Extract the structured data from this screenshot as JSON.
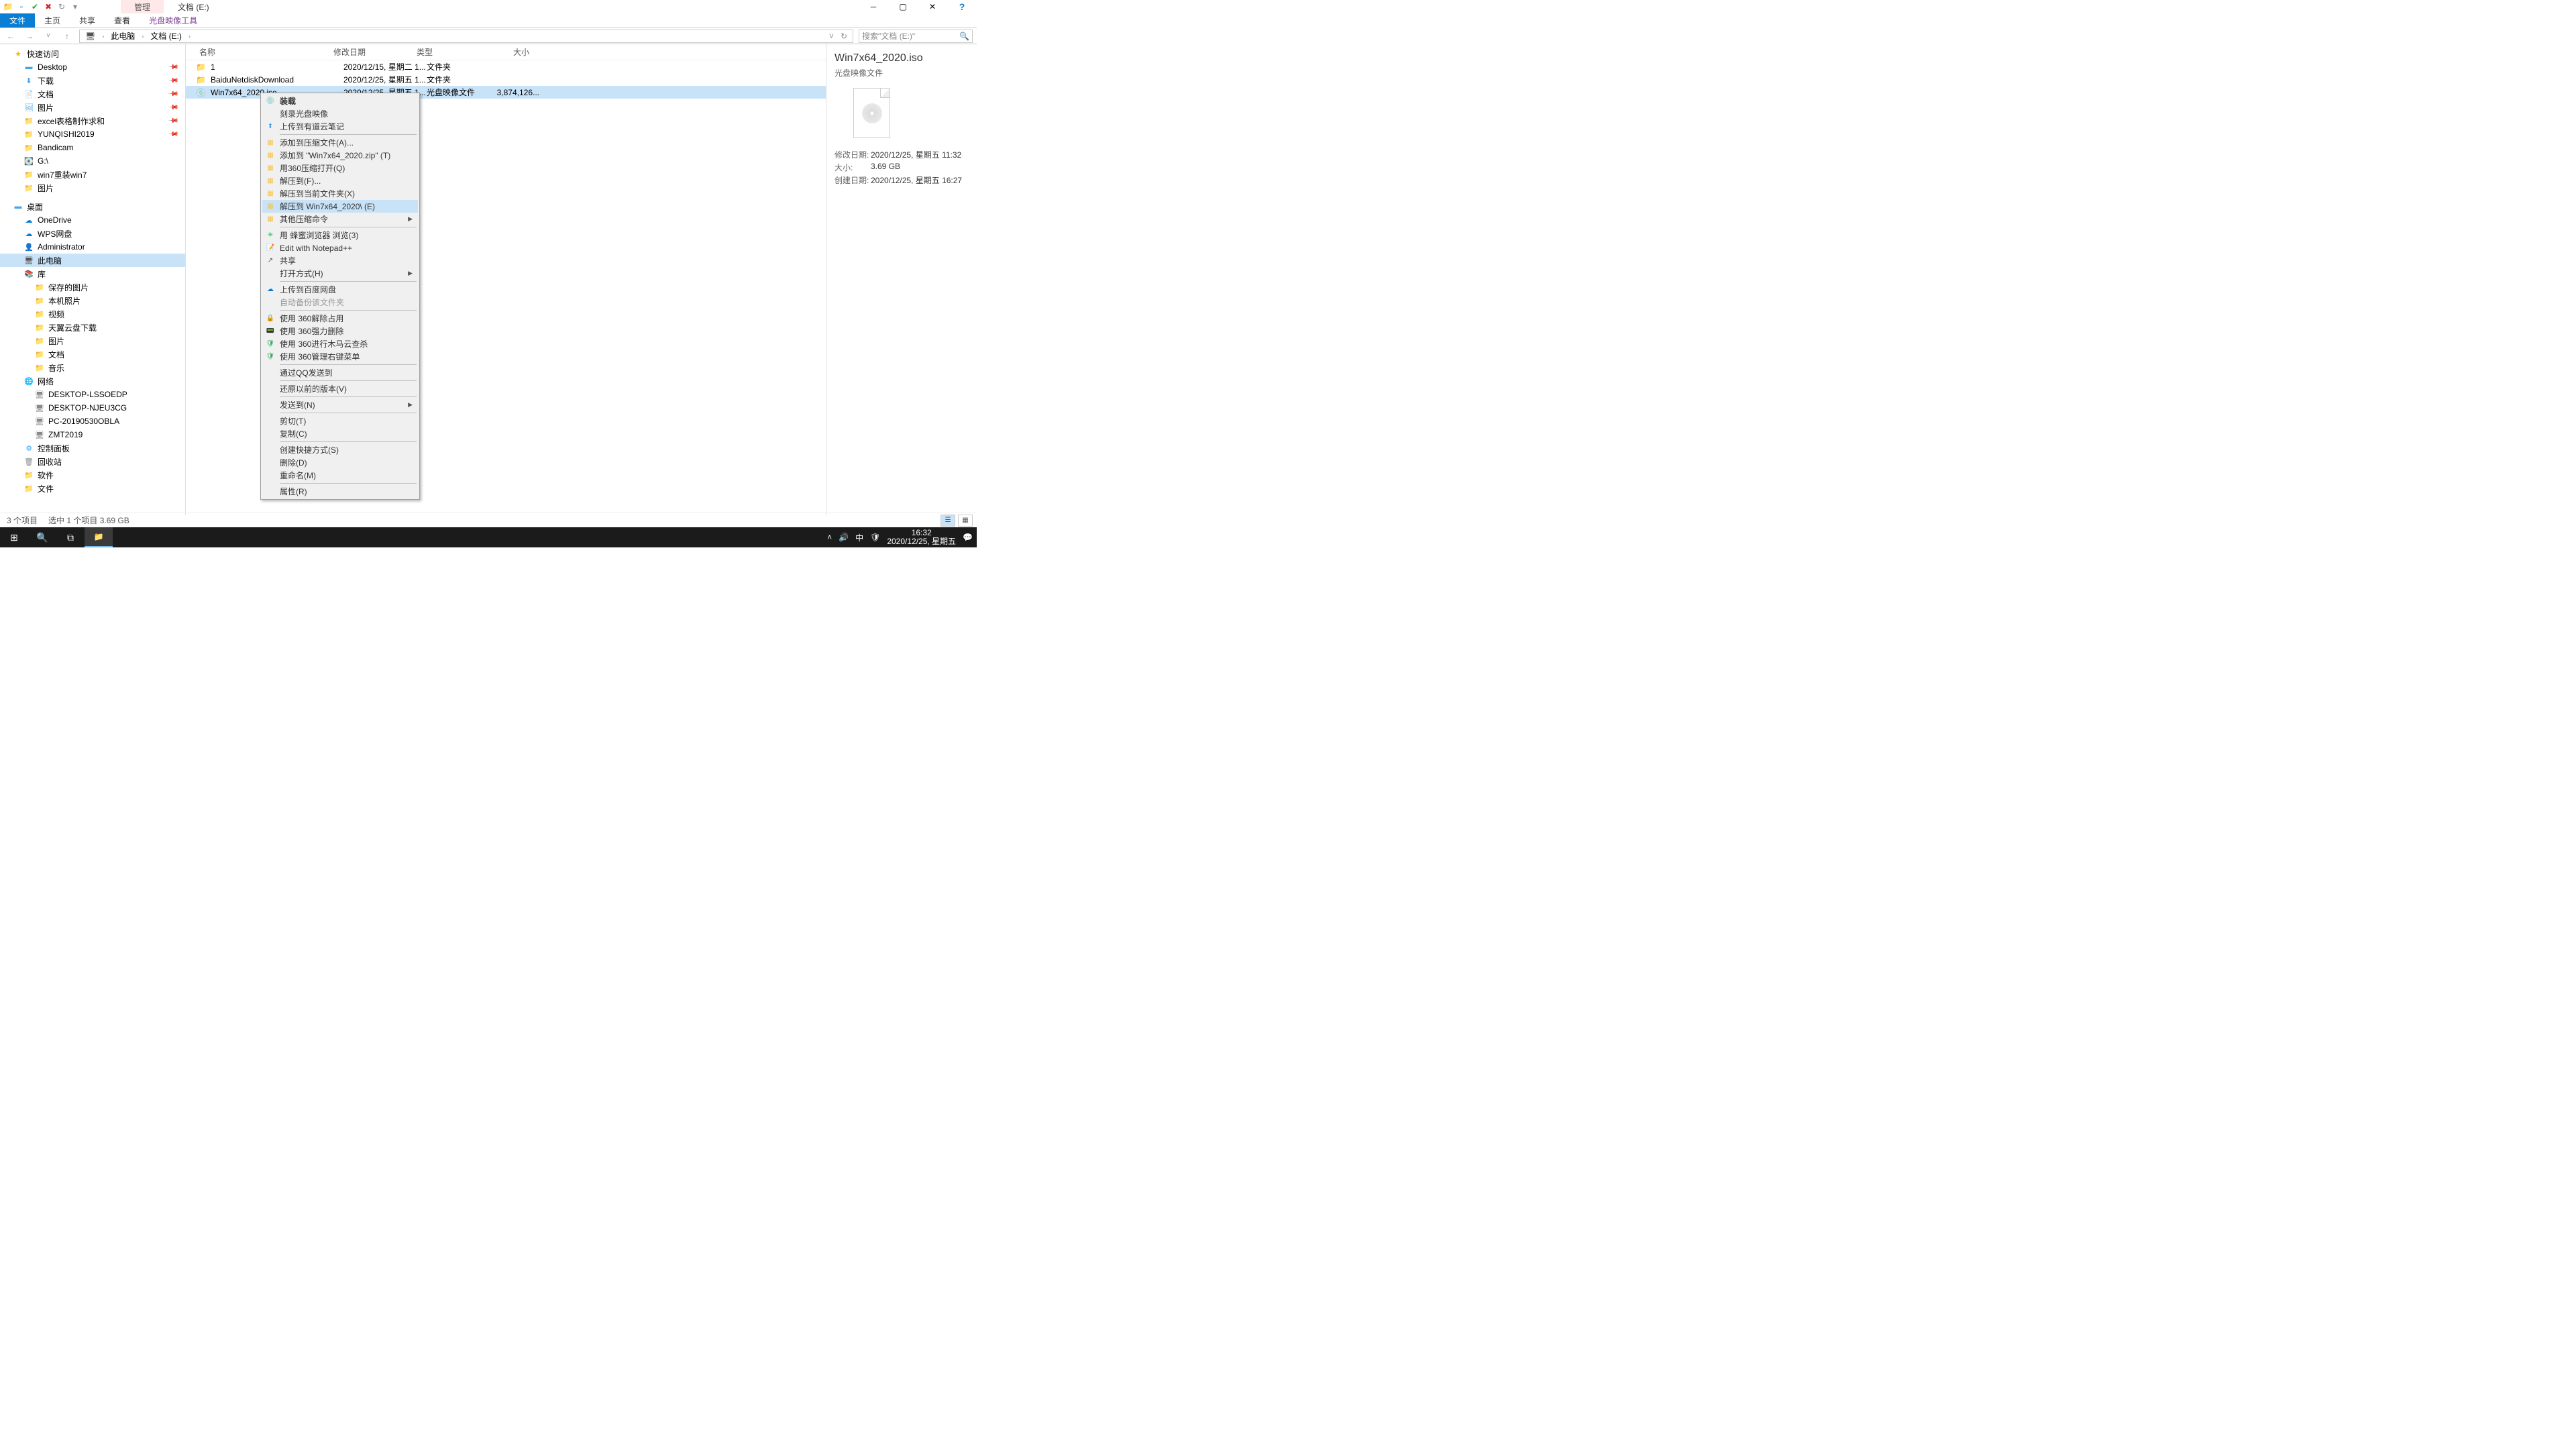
{
  "titlebar": {
    "tab_label": "管理",
    "title": "文档 (E:)"
  },
  "ribbon": {
    "file": "文件",
    "home": "主页",
    "share": "共享",
    "view": "查看",
    "disc_tools": "光盘映像工具"
  },
  "breadcrumb": {
    "this_pc": "此电脑",
    "drive": "文档 (E:)"
  },
  "search": {
    "placeholder": "搜索\"文档 (E:)\""
  },
  "nav": {
    "quick_access": "快速访问",
    "desktop": "Desktop",
    "downloads": "下载",
    "documents": "文档",
    "pictures": "图片",
    "excel_make": "excel表格制作求和",
    "yunqishi": "YUNQISHI2019",
    "bandicam": "Bandicam",
    "g_drive": "G:\\",
    "win7_reinstall": "win7重装win7",
    "pictures2": "图片",
    "desktop_zh": "桌面",
    "onedrive": "OneDrive",
    "wps": "WPS网盘",
    "admin": "Administrator",
    "this_pc": "此电脑",
    "library": "库",
    "saved_pics": "保存的图片",
    "local_photos": "本机照片",
    "videos": "视频",
    "tianyi": "天翼云盘下载",
    "pics3": "图片",
    "docs2": "文档",
    "music": "音乐",
    "network": "网络",
    "pc1": "DESKTOP-LSSOEDP",
    "pc2": "DESKTOP-NJEU3CG",
    "pc3": "PC-20190530OBLA",
    "pc4": "ZMT2019",
    "control": "控制面板",
    "recycle": "回收站",
    "software": "软件",
    "files": "文件"
  },
  "columns": {
    "name": "名称",
    "date": "修改日期",
    "type": "类型",
    "size": "大小"
  },
  "files": [
    {
      "name": "1",
      "date": "2020/12/15, 星期二 1...",
      "type": "文件夹",
      "size": ""
    },
    {
      "name": "BaiduNetdiskDownload",
      "date": "2020/12/25, 星期五 1...",
      "type": "文件夹",
      "size": ""
    },
    {
      "name": "Win7x64_2020.iso",
      "date": "2020/12/25, 星期五 1...",
      "type": "光盘映像文件",
      "size": "3,874,126..."
    }
  ],
  "context_menu": {
    "mount": "装载",
    "burn": "刻录光盘映像",
    "youdao": "上传到有道云笔记",
    "add_archive_a": "添加到压缩文件(A)...",
    "add_zip": "添加到 \"Win7x64_2020.zip\" (T)",
    "open_360": "用360压缩打开(Q)",
    "extract_f": "解压到(F)...",
    "extract_here": "解压到当前文件夹(X)",
    "extract_folder": "解压到 Win7x64_2020\\ (E)",
    "other_compress": "其他压缩命令",
    "fengmi": "用 蜂蜜浏览器 浏览(3)",
    "notepad": "Edit with Notepad++",
    "share": "共享",
    "open_with": "打开方式(H)",
    "baidu": "上传到百度网盘",
    "auto_backup": "自动备份该文件夹",
    "unlock_360": "使用 360解除占用",
    "force_del_360": "使用 360强力删除",
    "scan_360": "使用 360进行木马云查杀",
    "manage_360": "使用 360管理右键菜单",
    "qq_send": "通过QQ发送到",
    "restore_prev": "还原以前的版本(V)",
    "send_to": "发送到(N)",
    "cut": "剪切(T)",
    "copy": "复制(C)",
    "shortcut": "创建快捷方式(S)",
    "delete": "删除(D)",
    "rename": "重命名(M)",
    "properties": "属性(R)"
  },
  "preview": {
    "title": "Win7x64_2020.iso",
    "type": "光盘映像文件",
    "mod_label": "修改日期:",
    "mod_val": "2020/12/25, 星期五 11:32",
    "size_label": "大小:",
    "size_val": "3.69 GB",
    "created_label": "创建日期:",
    "created_val": "2020/12/25, 星期五 16:27"
  },
  "status": {
    "items": "3 个项目",
    "selected": "选中 1 个项目  3.69 GB"
  },
  "taskbar": {
    "ime": "中",
    "time": "16:32",
    "date": "2020/12/25, 星期五"
  }
}
